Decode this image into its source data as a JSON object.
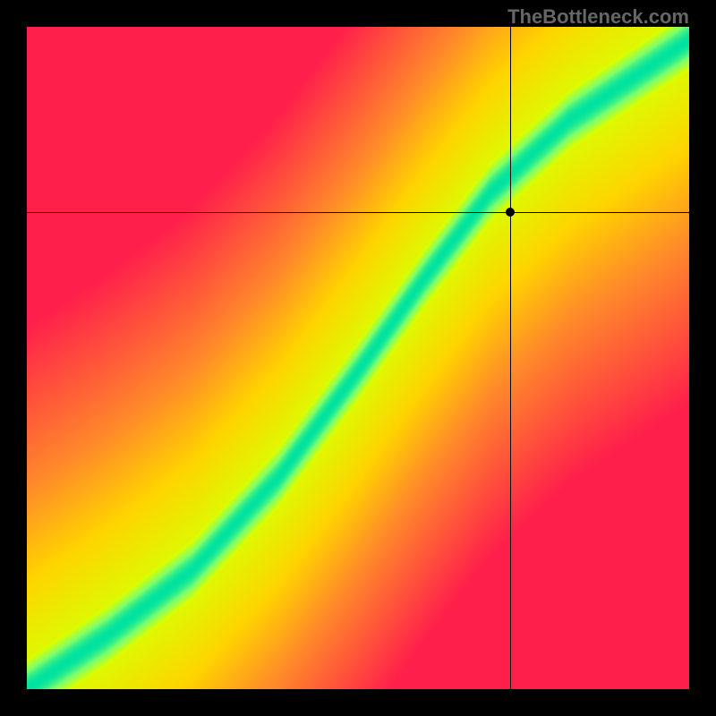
{
  "watermark": "TheBottleneck.com",
  "chart_data": {
    "type": "heatmap",
    "title": "",
    "xlabel": "",
    "ylabel": "",
    "xlim": [
      0,
      100
    ],
    "ylim": [
      0,
      100
    ],
    "crosshair": {
      "x": 73,
      "y": 72
    },
    "field_description": "Smooth 2D field: optimal (green) curve runs roughly diagonally from bottom-left to top-right with an S-bend; warm colors (yellow→orange→red) radiate outward from the curve indicating increasing mismatch.",
    "color_stops": [
      {
        "value": 0.0,
        "color": "#ff1f4b"
      },
      {
        "value": 0.35,
        "color": "#ff8a2a"
      },
      {
        "value": 0.55,
        "color": "#ffd400"
      },
      {
        "value": 0.75,
        "color": "#d9ff00"
      },
      {
        "value": 0.9,
        "color": "#7fff6b"
      },
      {
        "value": 1.0,
        "color": "#00e3a0"
      }
    ],
    "ridge_curve_points": [
      {
        "x": 0,
        "y": 0
      },
      {
        "x": 12,
        "y": 8
      },
      {
        "x": 25,
        "y": 18
      },
      {
        "x": 38,
        "y": 32
      },
      {
        "x": 50,
        "y": 48
      },
      {
        "x": 60,
        "y": 62
      },
      {
        "x": 70,
        "y": 75
      },
      {
        "x": 82,
        "y": 86
      },
      {
        "x": 100,
        "y": 98
      }
    ],
    "ridge_width": 8
  }
}
